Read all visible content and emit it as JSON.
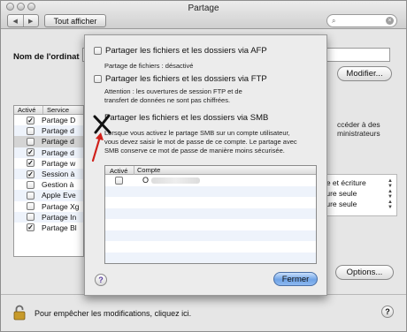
{
  "window": {
    "title": "Partage",
    "show_all_label": "Tout afficher"
  },
  "computer_name": {
    "label": "Nom de l'ordinat",
    "modify_button": "Modifier..."
  },
  "services": {
    "header_active": "Activé",
    "header_service": "Service",
    "rows": [
      {
        "label": "Partage D",
        "checked": true
      },
      {
        "label": "Partage d",
        "checked": false
      },
      {
        "label": "Partage d",
        "checked": false
      },
      {
        "label": "Partage d",
        "checked": true
      },
      {
        "label": "Partage w",
        "checked": true
      },
      {
        "label": "Session à",
        "checked": true
      },
      {
        "label": "Gestion à",
        "checked": false
      },
      {
        "label": "Apple Eve",
        "checked": false
      },
      {
        "label": "Partage Xg",
        "checked": false
      },
      {
        "label": "Partage In",
        "checked": false
      },
      {
        "label": "Partage Bl",
        "checked": true
      }
    ]
  },
  "right_panel": {
    "access_text_1": "ccéder à des",
    "access_text_2": "ministrateurs",
    "permissions": [
      "re et écriture",
      "ture seule",
      "ture seule"
    ],
    "options_button": "Options..."
  },
  "footer": {
    "lock_text": "Pour empêcher les modifications, cliquez ici.",
    "help": "?"
  },
  "sheet": {
    "afp": {
      "label": "Partager les fichiers et les dossiers via AFP",
      "checked": false,
      "desc": "Partage de fichiers : désactivé"
    },
    "ftp": {
      "label": "Partager les fichiers et les dossiers via FTP",
      "checked": false,
      "desc_1": "Attention : les ouvertures de session FTP et de",
      "desc_2": "transfert de données ne sont pas chiffrées."
    },
    "smb": {
      "label": "Partager les fichiers et les dossiers via SMB",
      "checked": true,
      "desc_1": "Lorsque vous activez le partage SMB sur un compte utilisateur,",
      "desc_2": "vous devez saisir le mot de passe de ce compte. Le partage avec",
      "desc_3": "SMB conserve ce mot de passe de manière moins sécurisée."
    },
    "accounts": {
      "header_active": "Activé",
      "header_account": "Compte",
      "rows": [
        {
          "name": "O",
          "checked": false
        }
      ]
    },
    "help": "?",
    "close_button": "Fermer"
  },
  "colors": {
    "accent": "#6fa3e6",
    "selected_row": "#d4d4d4",
    "stripe": "#eef3fb",
    "annotation": "#d0201a"
  }
}
